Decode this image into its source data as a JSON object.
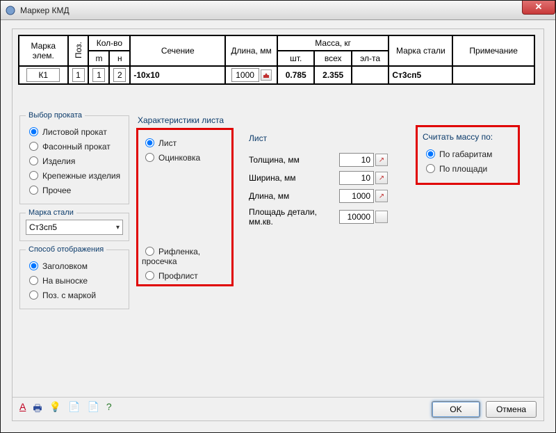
{
  "window": {
    "title": "Маркер КМД"
  },
  "table": {
    "headers": {
      "mark": "Марка элем.",
      "pos": "Поз.",
      "qty": "Кол-во",
      "qty_m": "m",
      "qty_n": "н",
      "section": "Сечение",
      "length": "Длина, мм",
      "mass": "Масса, кг",
      "mass_pc": "шт.",
      "mass_all": "всех",
      "mass_el": "эл-та",
      "steel": "Марка стали",
      "note": "Примечание"
    },
    "row": {
      "mark": "К1",
      "pos": "1",
      "m": "1",
      "n": "2",
      "section": "-10x10",
      "length": "1000",
      "mass_pc": "0.785",
      "mass_all": "2.355",
      "mass_el": "",
      "steel": "Ст3сп5",
      "note": ""
    }
  },
  "left": {
    "rolled": {
      "legend": "Выбор проката",
      "options": {
        "sheet": "Листовой прокат",
        "shape": "Фасонный прокат",
        "goods": "Изделия",
        "fastener": "Крепежные изделия",
        "other": "Прочее"
      }
    },
    "steel": {
      "legend": "Марка стали",
      "value": "Ст3сп5"
    },
    "display": {
      "legend": "Способ отображения",
      "options": {
        "header": "Заголовком",
        "leader": "На выноске",
        "posmark": "Поз. с маркой"
      }
    }
  },
  "sheet_char": {
    "title": "Характеристики листа",
    "opts": {
      "list": "Лист",
      "zinc": "Оцинковка",
      "riffle": "Рифленка, просечка",
      "proflist": "Профлист"
    }
  },
  "list_props": {
    "title": "Лист",
    "thick_label": "Толщина, мм",
    "thick": "10",
    "width_label": "Ширина, мм",
    "width": "10",
    "length_label": "Длина, мм",
    "length": "1000",
    "area_label": "Площадь детали, мм.кв.",
    "area": "10000"
  },
  "mass_by": {
    "title": "Считать массу по:",
    "gab": "По габаритам",
    "area": "По площади"
  },
  "buttons": {
    "ok": "OK",
    "cancel": "Отмена"
  }
}
